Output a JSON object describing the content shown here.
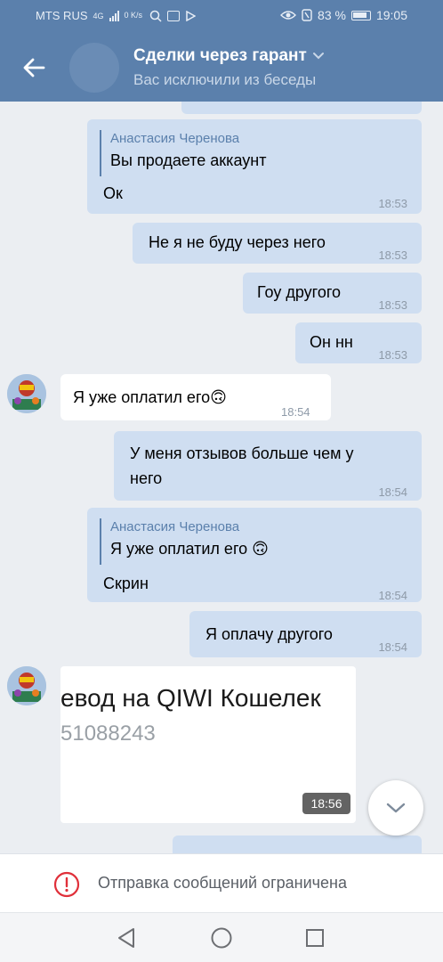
{
  "status_bar": {
    "carrier": "MTS RUS",
    "network": "4G",
    "data_speed": "0 K/s",
    "battery": "83 %",
    "time": "19:05"
  },
  "header": {
    "title": "Сделки через гарант",
    "subtitle": "Вас исключили из беседы",
    "back_icon": "arrow-left-icon",
    "title_chevron_icon": "chevron-down-icon"
  },
  "messages": [
    {
      "id": 1,
      "direction": "out",
      "quote_author": "Анастасия Черенова",
      "quote_text": "Вы продаете аккаунт",
      "text": "Ок",
      "time": "18:53"
    },
    {
      "id": 2,
      "direction": "out",
      "text": "Не я не буду через него",
      "time": "18:53"
    },
    {
      "id": 3,
      "direction": "out",
      "text": "Гоу другого",
      "time": "18:53"
    },
    {
      "id": 4,
      "direction": "out",
      "text": "Он нн",
      "time": "18:53"
    },
    {
      "id": 5,
      "direction": "in",
      "text": "Я уже оплатил его",
      "emoji": "🙃",
      "time": "18:54"
    },
    {
      "id": 6,
      "direction": "out",
      "text_line1": "У меня отзывов больше чем у",
      "text_line2": "него",
      "time": "18:54"
    },
    {
      "id": 7,
      "direction": "out",
      "quote_author": "Анастасия Черенова",
      "quote_text": "Я уже оплатил его",
      "quote_emoji": "🙃",
      "text": "Скрин",
      "time": "18:54"
    },
    {
      "id": 8,
      "direction": "out",
      "text": "Я оплачу другого",
      "time": "18:54"
    },
    {
      "id": 9,
      "direction": "in",
      "image_caption_line1": "евод на QIWI Кошелек",
      "image_caption_line2": "51088243",
      "time": "18:56"
    }
  ],
  "restriction": {
    "text": "Отправка сообщений ограничена",
    "icon": "alert-circle-icon",
    "color": "#e0303a"
  },
  "colors": {
    "header": "#5b80ac",
    "outgoing_bubble": "#cfdef1",
    "incoming_bubble": "#ffffff",
    "background": "#ebeef2"
  }
}
